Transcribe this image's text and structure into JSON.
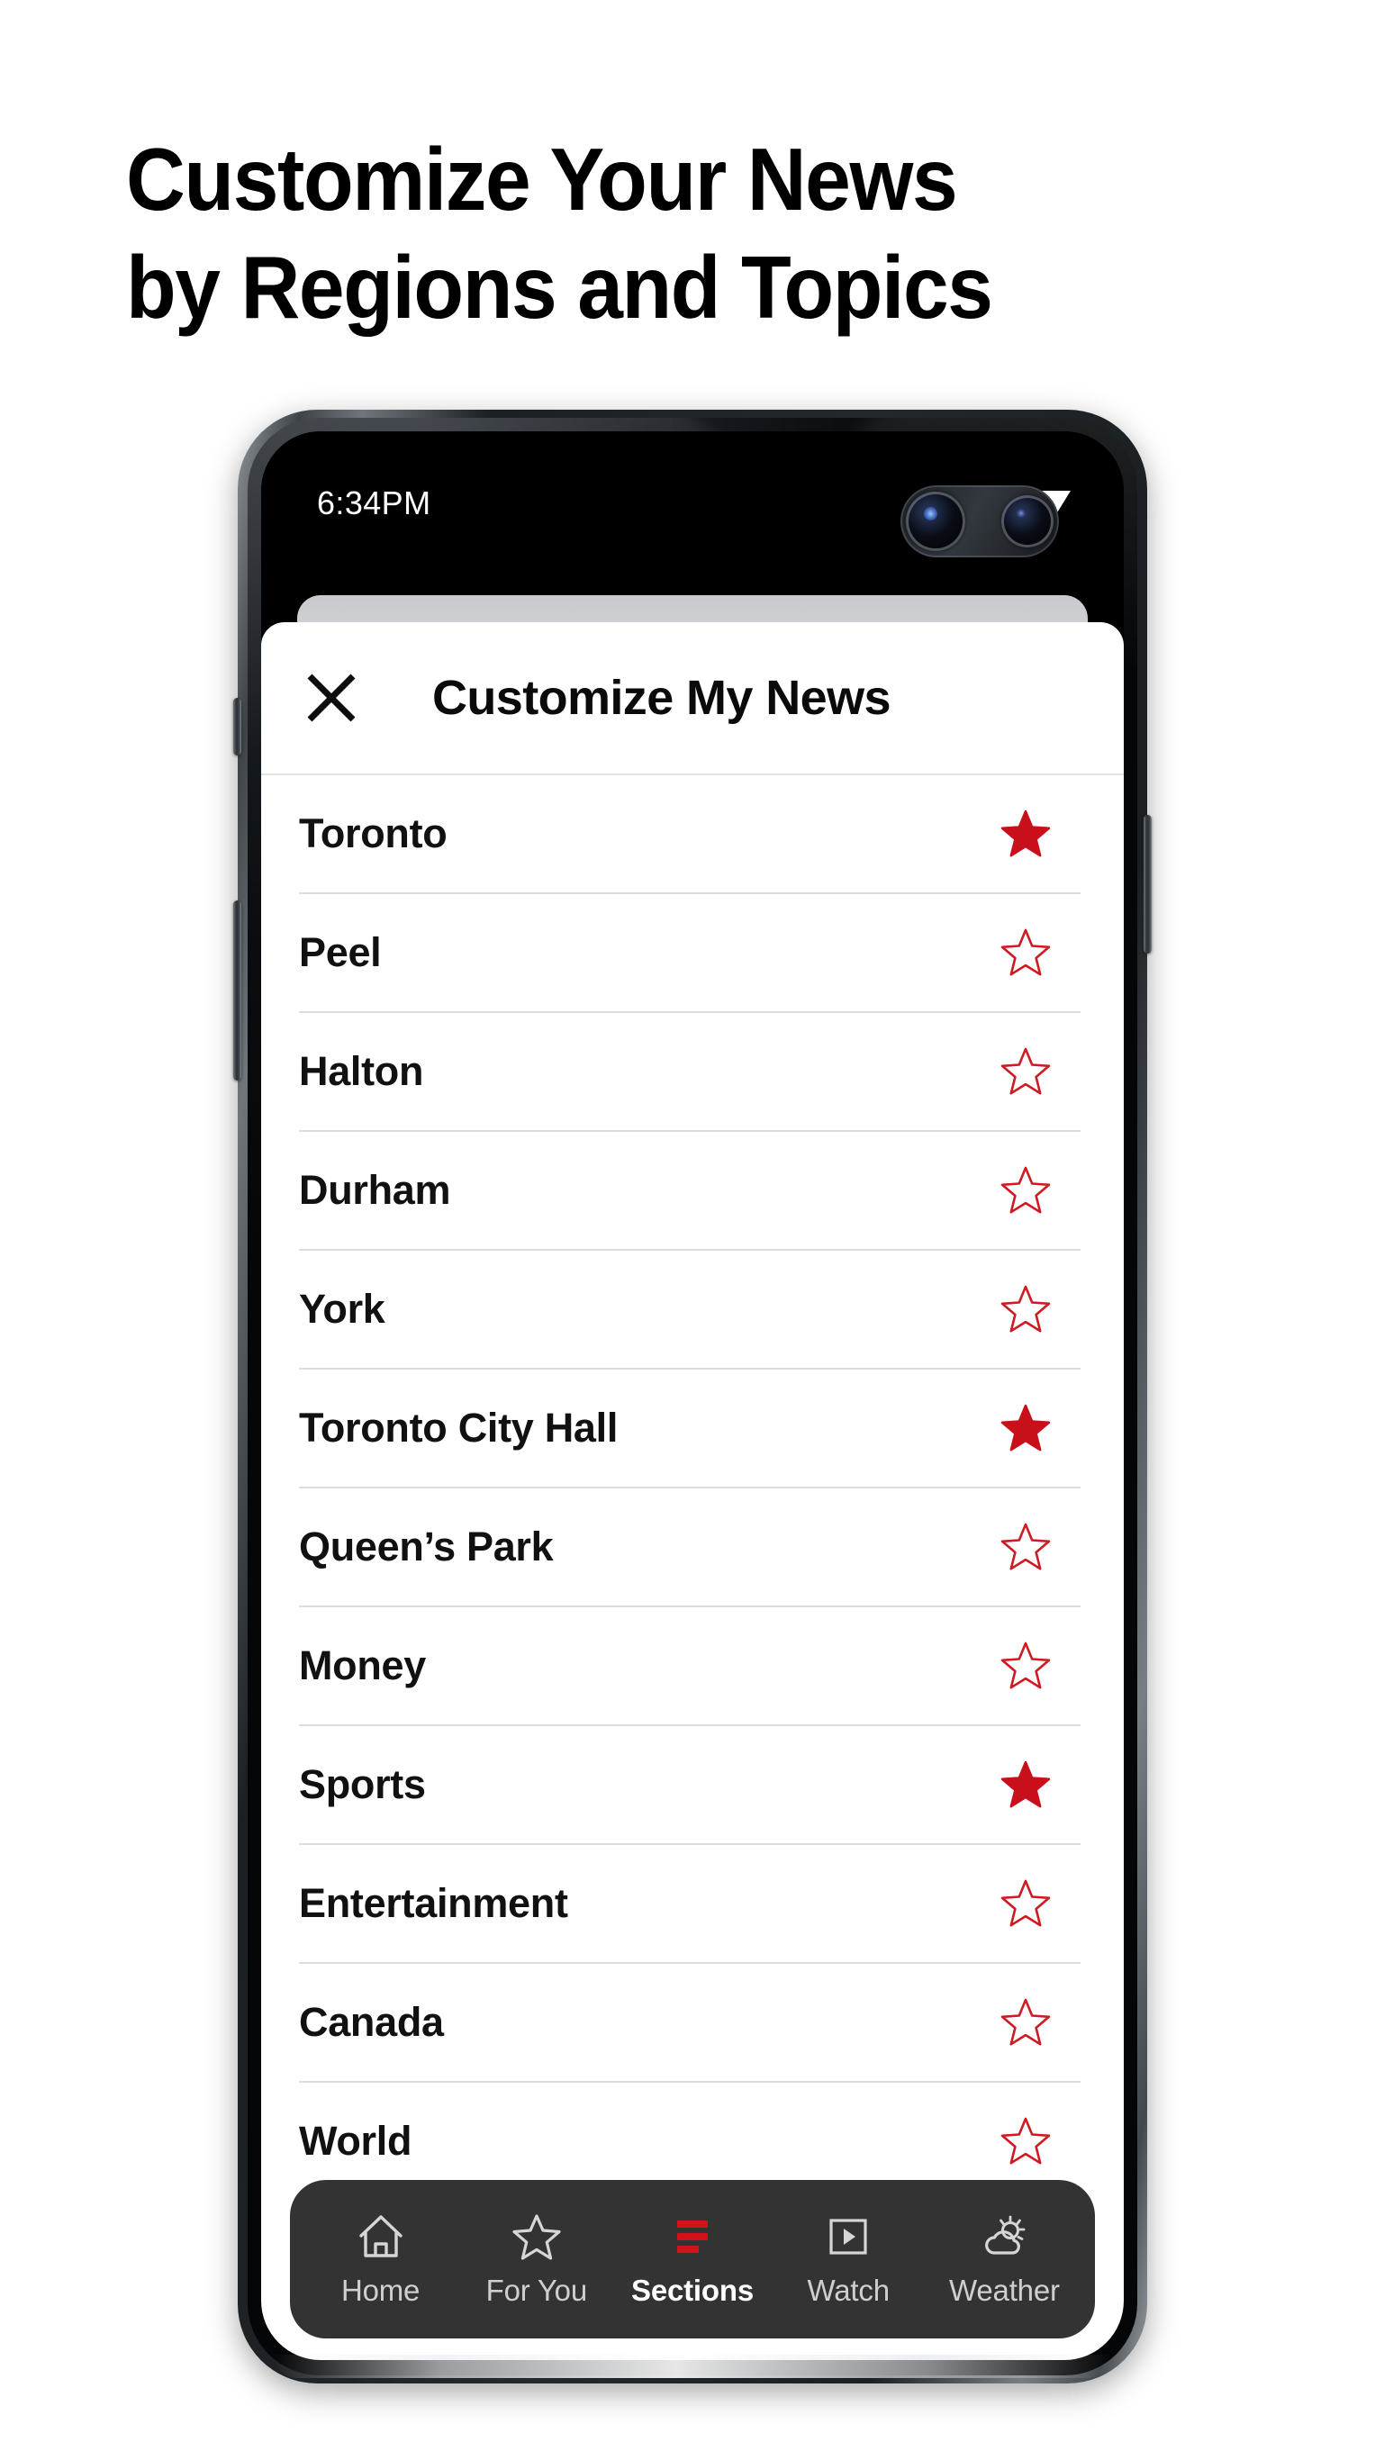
{
  "headline": {
    "line1": "Customize Your News",
    "line2": "by Regions and Topics"
  },
  "colors": {
    "brand_red": "#C8101A",
    "star_outline": "#CF1A22",
    "nav_background": "#333333",
    "device_rail": "#23282C",
    "text_primary": "#111111"
  },
  "phone": {
    "status_bar": {
      "time": "6:34PM",
      "icons": [
        "signal-icon",
        "battery-icon",
        "wifi-icon"
      ],
      "camera": "dual-punch-hole-camera"
    }
  },
  "app": {
    "header": {
      "close_icon": "close-icon",
      "title": "Customize My News"
    },
    "topics": [
      {
        "label": "Toronto",
        "starred": true,
        "star_icon": "star-filled-icon"
      },
      {
        "label": "Peel",
        "starred": false,
        "star_icon": "star-outline-icon"
      },
      {
        "label": "Halton",
        "starred": false,
        "star_icon": "star-outline-icon"
      },
      {
        "label": "Durham",
        "starred": false,
        "star_icon": "star-outline-icon"
      },
      {
        "label": "York",
        "starred": false,
        "star_icon": "star-outline-icon"
      },
      {
        "label": "Toronto City Hall",
        "starred": true,
        "star_icon": "star-filled-icon"
      },
      {
        "label": "Queen’s Park",
        "starred": false,
        "star_icon": "star-outline-icon"
      },
      {
        "label": "Money",
        "starred": false,
        "star_icon": "star-outline-icon"
      },
      {
        "label": "Sports",
        "starred": true,
        "star_icon": "star-filled-icon"
      },
      {
        "label": "Entertainment",
        "starred": false,
        "star_icon": "star-outline-icon"
      },
      {
        "label": "Canada",
        "starred": false,
        "star_icon": "star-outline-icon"
      },
      {
        "label": "World",
        "starred": false,
        "star_icon": "star-outline-icon"
      }
    ],
    "bottom_nav": [
      {
        "label": "Home",
        "icon": "home-icon",
        "active": false
      },
      {
        "label": "For You",
        "icon": "star-icon",
        "active": false
      },
      {
        "label": "Sections",
        "icon": "menu-icon",
        "active": true
      },
      {
        "label": "Watch",
        "icon": "play-box-icon",
        "active": false
      },
      {
        "label": "Weather",
        "icon": "weather-icon",
        "active": false
      }
    ]
  }
}
